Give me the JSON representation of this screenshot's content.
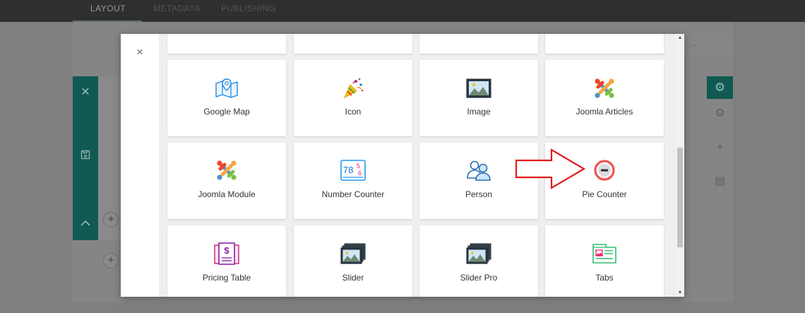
{
  "top_tabs": [
    "LAYOUT",
    "METADATA",
    "PUBLISHING"
  ],
  "modal": {
    "close_symbol": "×",
    "addons": [
      {
        "label": "Google Map",
        "icon": "google-map-icon"
      },
      {
        "label": "Icon",
        "icon": "party-popper-icon"
      },
      {
        "label": "Image",
        "icon": "image-icon"
      },
      {
        "label": "Joomla Articles",
        "icon": "joomla-icon"
      },
      {
        "label": "Joomla Module",
        "icon": "joomla-icon"
      },
      {
        "label": "Number Counter",
        "icon": "number-counter-icon"
      },
      {
        "label": "Person",
        "icon": "person-icon"
      },
      {
        "label": "Pie Counter",
        "icon": "pie-counter-icon"
      },
      {
        "label": "Pricing Table",
        "icon": "pricing-table-icon"
      },
      {
        "label": "Slider",
        "icon": "slider-icon"
      },
      {
        "label": "Slider Pro",
        "icon": "slider-pro-icon"
      },
      {
        "label": "Tabs",
        "icon": "tabs-icon"
      }
    ],
    "number_counter_digits": {
      "a": "78",
      "b": "5",
      "c": "6"
    }
  },
  "colors": {
    "teal": "#105a53",
    "annotation_arrow": "#e31b1b",
    "pie_ring": "#f05353"
  }
}
